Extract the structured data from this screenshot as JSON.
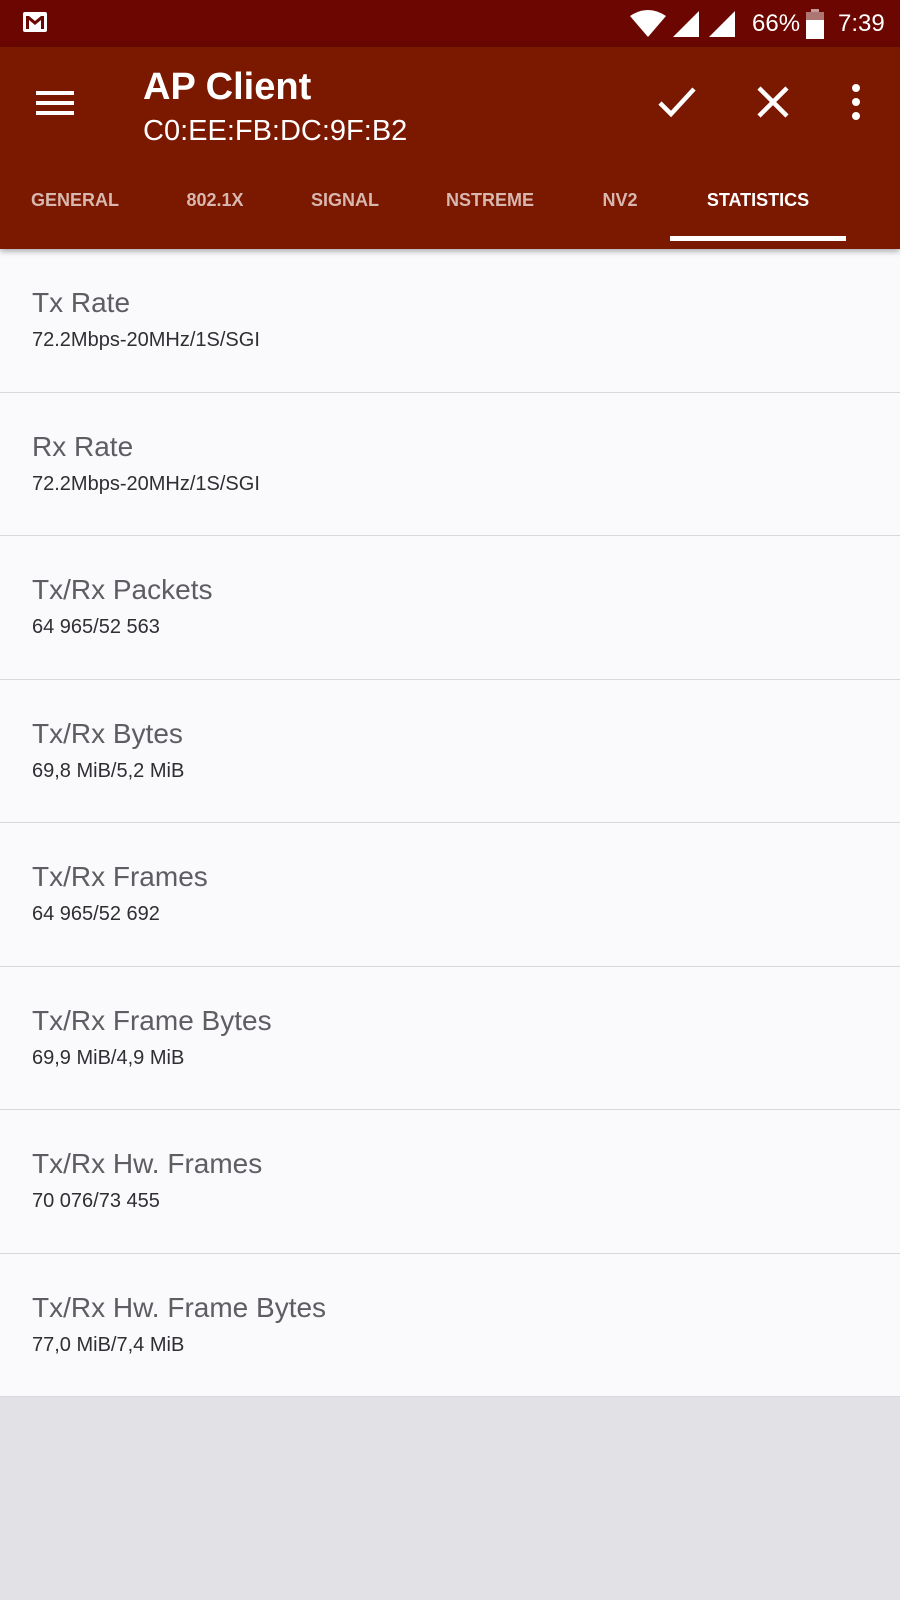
{
  "status_bar": {
    "notification_icon": "gmail-icon",
    "battery_percent": "66%",
    "time": "7:39"
  },
  "app_bar": {
    "title": "AP Client",
    "subtitle": "C0:EE:FB:DC:9F:B2",
    "background_color": "#7b1800",
    "actions": [
      "check-icon",
      "close-icon",
      "more-vert-icon"
    ]
  },
  "tabs": [
    {
      "label": "GENERAL",
      "active": false
    },
    {
      "label": "802.1X",
      "active": false
    },
    {
      "label": "SIGNAL",
      "active": false
    },
    {
      "label": "NSTREME",
      "active": false
    },
    {
      "label": "NV2",
      "active": false
    },
    {
      "label": "STATISTICS",
      "active": true
    }
  ],
  "stats": [
    {
      "label": "Tx Rate",
      "value": "72.2Mbps-20MHz/1S/SGI"
    },
    {
      "label": "Rx Rate",
      "value": "72.2Mbps-20MHz/1S/SGI"
    },
    {
      "label": "Tx/Rx Packets",
      "value": "64 965/52 563"
    },
    {
      "label": "Tx/Rx Bytes",
      "value": "69,8 MiB/5,2 MiB"
    },
    {
      "label": "Tx/Rx Frames",
      "value": "64 965/52 692"
    },
    {
      "label": "Tx/Rx Frame Bytes",
      "value": "69,9 MiB/4,9 MiB"
    },
    {
      "label": "Tx/Rx Hw. Frames",
      "value": "70 076/73 455"
    },
    {
      "label": "Tx/Rx Hw. Frame Bytes",
      "value": "77,0 MiB/7,4 MiB"
    }
  ]
}
